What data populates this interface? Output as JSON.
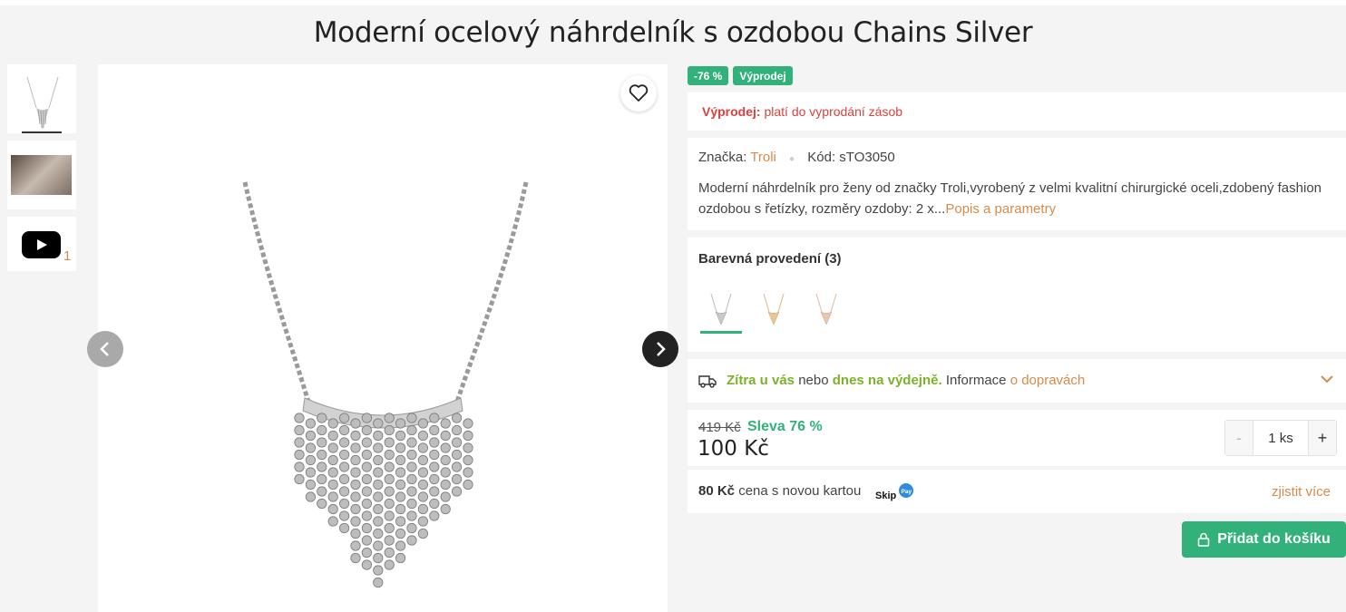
{
  "product": {
    "title": "Moderní ocelový náhrdelník s ozdobou Chains Silver"
  },
  "gallery": {
    "thumbnails": [
      {
        "type": "image",
        "name": "necklace-thumbnail"
      },
      {
        "type": "image",
        "name": "model-photo-thumbnail"
      },
      {
        "type": "video",
        "name": "youtube-icon"
      }
    ],
    "extra_count": "1"
  },
  "badges": [
    "-76 %",
    "Výprodej"
  ],
  "sale": {
    "label": "Výprodej:",
    "text": "platí do vyprodání zásob"
  },
  "info": {
    "brand_label": "Značka:",
    "brand": "Troli",
    "code_label": "Kód:",
    "code": "sTO3050",
    "description": "Moderní náhrdelník pro ženy od značky Troli,vyrobený z velmi kvalitní chirurgické oceli,zdobený fashion ozdobou s řetízky, rozměry ozdoby: 2 x...",
    "more_link": "Popis a parametry"
  },
  "variants": {
    "title": "Barevná provedení (3)",
    "items": [
      "silver",
      "gold",
      "rose-gold"
    ]
  },
  "delivery": {
    "fast": "Zítra u vás",
    "connector": "nebo",
    "pickup": "dnes na výdejně.",
    "info": "Informace",
    "link": "o dopravách"
  },
  "price": {
    "old": "419 Kč",
    "discount": "Sleva 76 %",
    "current": "100 Kč"
  },
  "quantity": {
    "minus": "-",
    "value": "1 ks",
    "plus": "+"
  },
  "card_price": {
    "amount": "80 Kč",
    "text": "cena s novou kartou",
    "link": "zjistit více"
  },
  "cart": {
    "button": "Přidat do košíku"
  },
  "colors": {
    "accent_green": "#32b27a",
    "link_orange": "#d88a4a",
    "sale_red": "#d9413f",
    "delivery_green": "#7ab32a"
  }
}
